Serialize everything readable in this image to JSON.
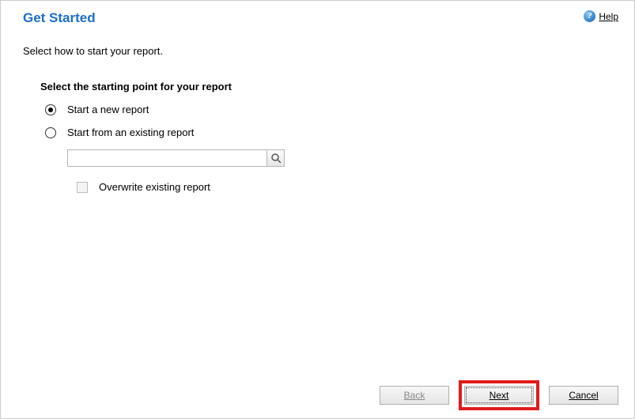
{
  "header": {
    "title": "Get Started",
    "help_label": "Help",
    "help_icon_char": "?"
  },
  "instruction": "Select how to start your report.",
  "section": {
    "heading": "Select the starting point for your report",
    "options": [
      {
        "label": "Start a new report",
        "selected": true
      },
      {
        "label": "Start from an existing report",
        "selected": false
      }
    ],
    "lookup_value": "",
    "lookup_placeholder": "",
    "overwrite_label": "Overwrite existing report",
    "overwrite_checked": false
  },
  "footer": {
    "back_label": "Back",
    "next_label": "Next",
    "cancel_label": "Cancel"
  }
}
